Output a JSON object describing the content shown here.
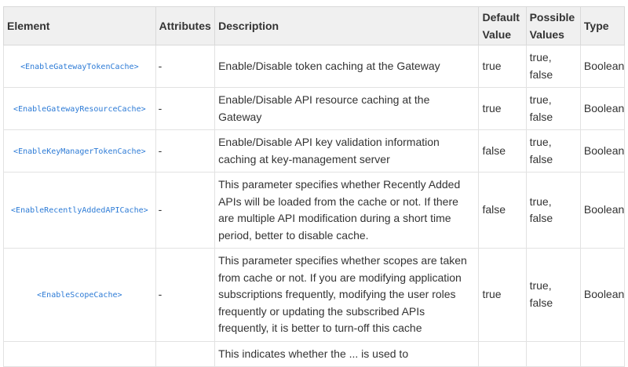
{
  "table": {
    "headers": {
      "element": "Element",
      "attributes": "Attributes",
      "description": "Description",
      "default_value": "Default Value",
      "possible_values": "Possible Values",
      "type": "Type"
    },
    "rows": [
      {
        "element": "<EnableGatewayTokenCache>",
        "attributes": "-",
        "description": "Enable/Disable token caching at the Gateway",
        "default_value": "true",
        "possible_values": "true, false",
        "type": "Boolean"
      },
      {
        "element": "<EnableGatewayResourceCache>",
        "attributes": "-",
        "description": "Enable/Disable API resource caching at the Gateway",
        "default_value": "true",
        "possible_values": "true, false",
        "type": "Boolean"
      },
      {
        "element": "<EnableKeyManagerTokenCache>",
        "attributes": "-",
        "description": "Enable/Disable API key validation information caching at key-management server",
        "default_value": "false",
        "possible_values": "true, false",
        "type": "Boolean"
      },
      {
        "element": "<EnableRecentlyAddedAPICache>",
        "attributes": "-",
        "description": "This parameter specifies whether Recently Added APIs will be loaded from the cache or not.  If there are multiple API modification during a short time period, better to disable cache.",
        "default_value": "false",
        "possible_values": "true, false",
        "type": "Boolean"
      },
      {
        "element": "<EnableScopeCache>",
        "attributes": "-",
        "description": "This parameter specifies whether scopes are taken from cache or not. If you are modifying application subscriptions frequently, modifying the user roles frequently or updating the subscribed APIs frequently, it  is better to turn-off this cache",
        "default_value": "true",
        "possible_values": "true, false",
        "type": "Boolean"
      },
      {
        "element": "",
        "attributes": "",
        "description": "This indicates whether the ... is used to",
        "default_value": "",
        "possible_values": "",
        "type": ""
      }
    ]
  }
}
